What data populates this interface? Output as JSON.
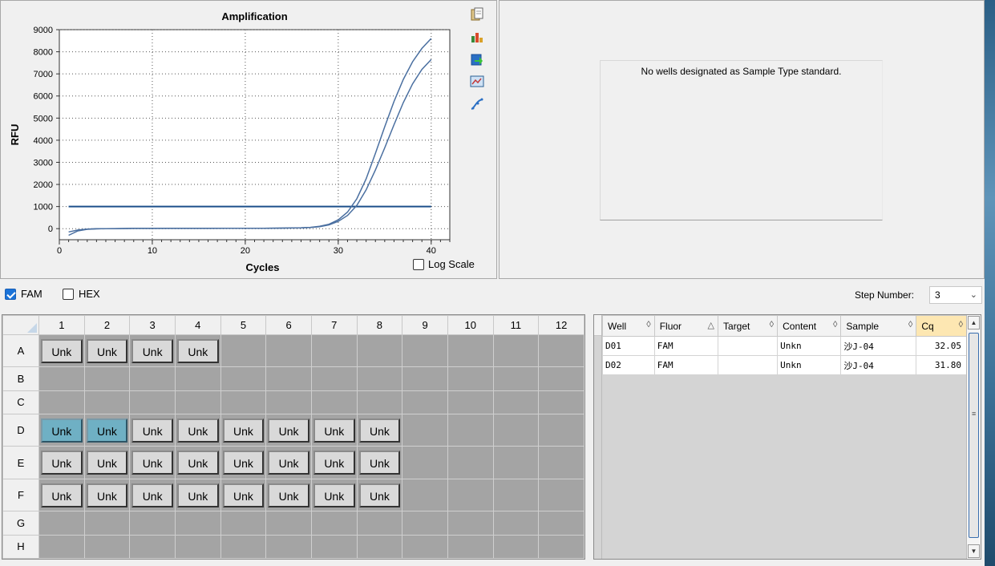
{
  "chart_data": {
    "type": "line",
    "title": "Amplification",
    "xlabel": "Cycles",
    "ylabel": "RFU",
    "xlim": [
      0,
      42
    ],
    "ylim": [
      -500,
      9000
    ],
    "x_ticks": [
      0,
      10,
      20,
      30,
      40
    ],
    "y_ticks": [
      0,
      1000,
      2000,
      3000,
      4000,
      5000,
      6000,
      7000,
      8000,
      9000
    ],
    "grid": true,
    "threshold": 1000,
    "series": [
      {
        "color": "#4a6fa0",
        "x": [
          1,
          2,
          3,
          4,
          5,
          6,
          8,
          10,
          12,
          14,
          16,
          18,
          20,
          22,
          24,
          26,
          27,
          28,
          29,
          30,
          31,
          32,
          33,
          34,
          35,
          36,
          37,
          38,
          39,
          40
        ],
        "y": [
          -300,
          -100,
          -30,
          -10,
          0,
          0,
          10,
          10,
          10,
          10,
          10,
          15,
          15,
          20,
          25,
          40,
          60,
          110,
          200,
          400,
          750,
          1350,
          2250,
          3400,
          4600,
          5750,
          6750,
          7550,
          8150,
          8600
        ]
      },
      {
        "color": "#4a6fa0",
        "x": [
          1,
          2,
          3,
          4,
          5,
          6,
          8,
          10,
          12,
          14,
          16,
          18,
          20,
          22,
          24,
          26,
          27,
          28,
          29,
          30,
          31,
          32,
          33,
          34,
          35,
          36,
          37,
          38,
          39,
          40
        ],
        "y": [
          -150,
          -60,
          -20,
          0,
          0,
          5,
          10,
          10,
          15,
          15,
          15,
          15,
          20,
          20,
          25,
          35,
          55,
          90,
          170,
          330,
          600,
          1050,
          1750,
          2650,
          3650,
          4700,
          5700,
          6550,
          7200,
          7650
        ]
      }
    ]
  },
  "standard_curve": {
    "message": "No wells designated as Sample Type standard."
  },
  "log_scale": {
    "label": "Log Scale",
    "checked": false
  },
  "fluors": [
    {
      "label": "FAM",
      "checked": true
    },
    {
      "label": "HEX",
      "checked": false
    }
  ],
  "step": {
    "label": "Step Number:",
    "value": "3"
  },
  "plate": {
    "columns": [
      "1",
      "2",
      "3",
      "4",
      "5",
      "6",
      "7",
      "8",
      "9",
      "10",
      "11",
      "12"
    ],
    "rows": [
      {
        "label": "A",
        "wells": [
          "Unk",
          "Unk",
          "Unk",
          "Unk",
          "",
          "",
          "",
          "",
          "",
          "",
          "",
          ""
        ],
        "selected": []
      },
      {
        "label": "B",
        "wells": [
          "",
          "",
          "",
          "",
          "",
          "",
          "",
          "",
          "",
          "",
          "",
          ""
        ],
        "selected": []
      },
      {
        "label": "C",
        "wells": [
          "",
          "",
          "",
          "",
          "",
          "",
          "",
          "",
          "",
          "",
          "",
          ""
        ],
        "selected": []
      },
      {
        "label": "D",
        "wells": [
          "Unk",
          "Unk",
          "Unk",
          "Unk",
          "Unk",
          "Unk",
          "Unk",
          "Unk",
          "",
          "",
          "",
          ""
        ],
        "selected": [
          0,
          1
        ]
      },
      {
        "label": "E",
        "wells": [
          "Unk",
          "Unk",
          "Unk",
          "Unk",
          "Unk",
          "Unk",
          "Unk",
          "Unk",
          "",
          "",
          "",
          ""
        ],
        "selected": []
      },
      {
        "label": "F",
        "wells": [
          "Unk",
          "Unk",
          "Unk",
          "Unk",
          "Unk",
          "Unk",
          "Unk",
          "Unk",
          "",
          "",
          "",
          ""
        ],
        "selected": []
      },
      {
        "label": "G",
        "wells": [
          "",
          "",
          "",
          "",
          "",
          "",
          "",
          "",
          "",
          "",
          "",
          ""
        ],
        "selected": []
      },
      {
        "label": "H",
        "wells": [
          "",
          "",
          "",
          "",
          "",
          "",
          "",
          "",
          "",
          "",
          "",
          ""
        ],
        "selected": []
      }
    ]
  },
  "results": {
    "headers": [
      {
        "label": "Well",
        "sort": "◊"
      },
      {
        "label": "Fluor",
        "sort": "△"
      },
      {
        "label": "Target",
        "sort": "◊"
      },
      {
        "label": "Content",
        "sort": "◊"
      },
      {
        "label": "Sample",
        "sort": "◊"
      },
      {
        "label": "Cq",
        "sort": "◊"
      }
    ],
    "rows": [
      [
        "D01",
        "FAM",
        "",
        "Unkn",
        "沙J-04",
        "32.05"
      ],
      [
        "D02",
        "FAM",
        "",
        "Unkn",
        "沙J-04",
        "31.80"
      ]
    ]
  },
  "icons": [
    "copy-icon",
    "chart-settings-icon",
    "export-icon",
    "image-icon",
    "curve-icon"
  ]
}
